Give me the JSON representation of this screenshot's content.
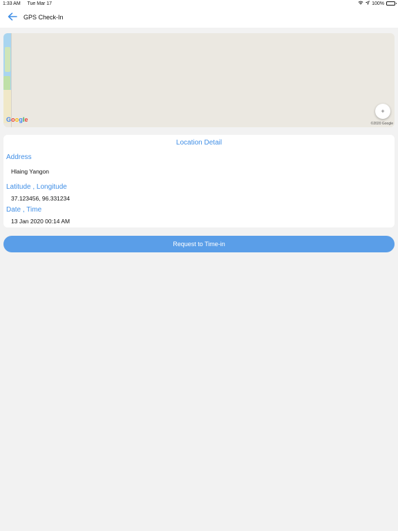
{
  "status_bar": {
    "time": "1:33 AM",
    "date": "Tue Mar 17",
    "battery": "100%",
    "icons": [
      "wifi-icon",
      "location-arrow-icon",
      "battery-icon"
    ]
  },
  "nav": {
    "title": "GPS Check-In",
    "back_icon": "arrow-left-icon"
  },
  "map": {
    "logo": {
      "g1": "G",
      "o1": "o",
      "o2": "o",
      "g2": "g",
      "l": "l",
      "e": "e"
    },
    "copyright": "©2020 Google",
    "zoom_label": "+"
  },
  "location_detail": {
    "title": "Location Detail",
    "address_label": "Address",
    "address_value": "Hlaing Yangon",
    "latlng_label": "Latitude , Longitude",
    "latlng_value": "37.123456, 96.331234",
    "datetime_label": "Date , Time",
    "datetime_value": "13 Jan 2020 00:14 AM"
  },
  "actions": {
    "request_label": "Request to Time-in"
  },
  "colors": {
    "accent": "#3f8ee6",
    "button": "#5a9ee8",
    "background": "#f2f2f2",
    "card": "#ffffff"
  }
}
